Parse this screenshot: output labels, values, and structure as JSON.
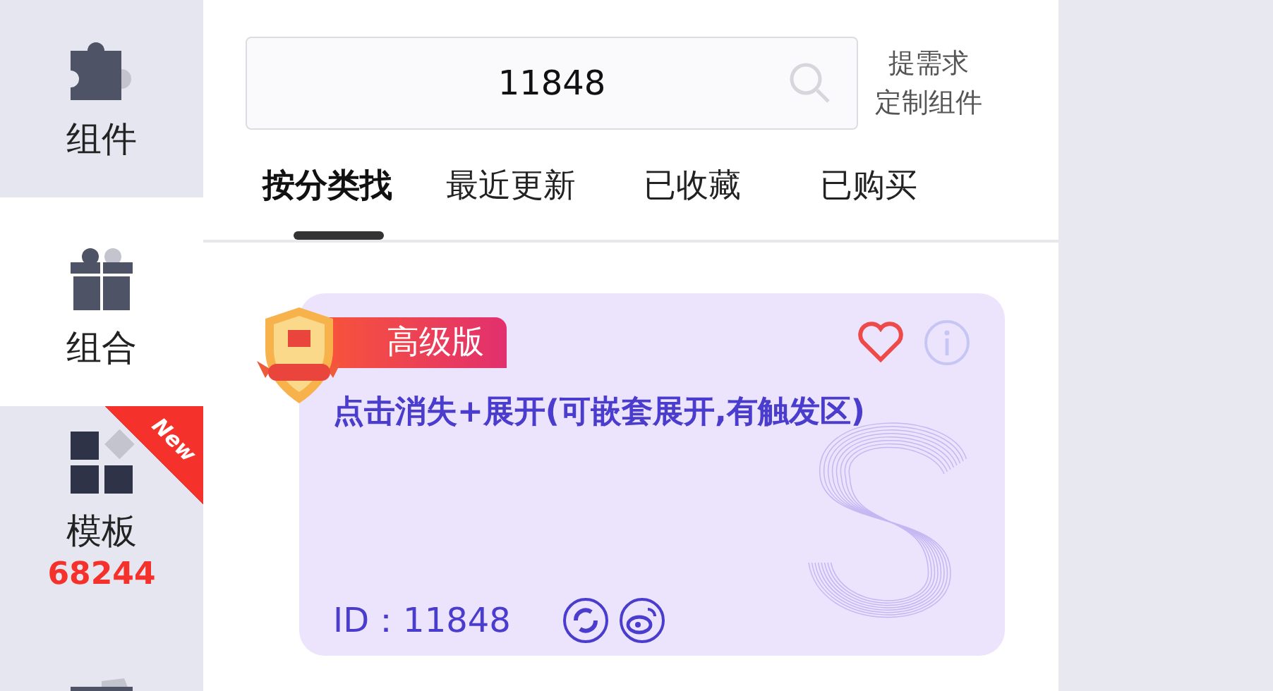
{
  "sidebar": {
    "items": [
      {
        "kind": "puzzle",
        "label": "组件",
        "selected": false
      },
      {
        "kind": "gift",
        "label": "组合",
        "selected": true
      },
      {
        "kind": "grid",
        "label": "模板",
        "selected": false,
        "badge": "New",
        "count": "68244"
      },
      {
        "kind": "folder",
        "selected": false
      }
    ]
  },
  "search": {
    "value": "11848"
  },
  "request_link": {
    "lines": [
      "提需求",
      "定制组件"
    ]
  },
  "tabs": [
    {
      "label": "按分类找",
      "selected": true
    },
    {
      "label": "最近更新",
      "selected": false
    },
    {
      "label": "已收藏",
      "selected": false
    },
    {
      "label": "已购买",
      "selected": false
    }
  ],
  "card": {
    "tier": "高级版",
    "title": "点击消失+展开(可嵌套展开,有触发区)",
    "id_text": "ID：11848"
  }
}
